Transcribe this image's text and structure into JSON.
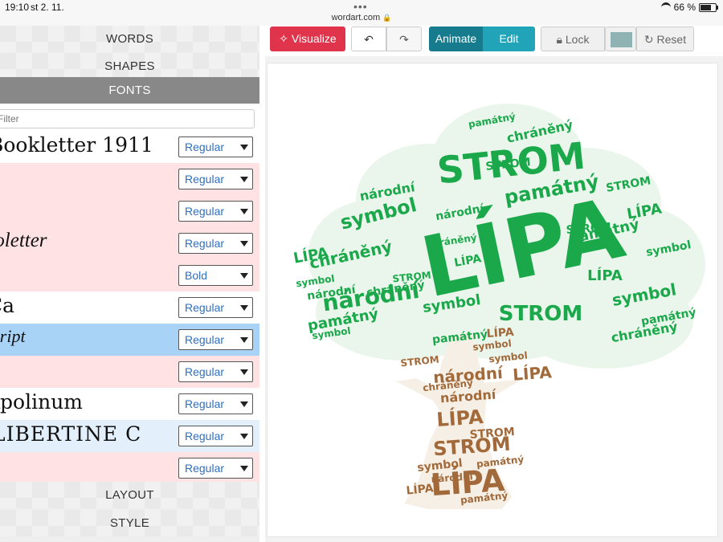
{
  "status": {
    "time": "19:10",
    "date": "st 2. 11.",
    "url": "wordart.com",
    "dots": "•••",
    "battery": "66 %"
  },
  "panel": {
    "sections": {
      "words": "WORDS",
      "shapes": "SHAPES",
      "fonts": "FONTS",
      "layout": "LAYOUT",
      "style": "STYLE"
    },
    "filter_placeholder": "Filter",
    "fonts": [
      {
        "sample": "Bookletter 1911",
        "style": "Regular"
      },
      {
        "sample": "",
        "style": "Regular"
      },
      {
        "sample": "",
        "style": "Regular"
      },
      {
        "sample": "Boletter",
        "style": "Regular"
      },
      {
        "sample": "",
        "style": "Bold"
      },
      {
        "sample": "Ca",
        "style": "Regular"
      },
      {
        "sample": "cript",
        "style": "Regular"
      },
      {
        "sample": "",
        "style": "Regular"
      },
      {
        "sample": "Apolinum",
        "style": "Regular"
      },
      {
        "sample": "LIBERTINE C",
        "style": "Regular"
      },
      {
        "sample": "",
        "style": "Regular"
      }
    ]
  },
  "toolbar": {
    "visualize": "Visualize",
    "undo": "↶",
    "redo": "↷",
    "animate": "Animate",
    "edit": "Edit",
    "lock": "Lock",
    "reset": "Reset",
    "swatch_color": "#8fb3b3"
  },
  "wordcloud": {
    "words": [
      "LÍPA",
      "STROM",
      "národní",
      "symbol",
      "památný",
      "chráněný"
    ],
    "colors": {
      "crown": "#1aa84a",
      "trunk": "#a26a3a",
      "crown_bg": "#eaf6ec",
      "trunk_bg": "#f6efe6"
    }
  }
}
